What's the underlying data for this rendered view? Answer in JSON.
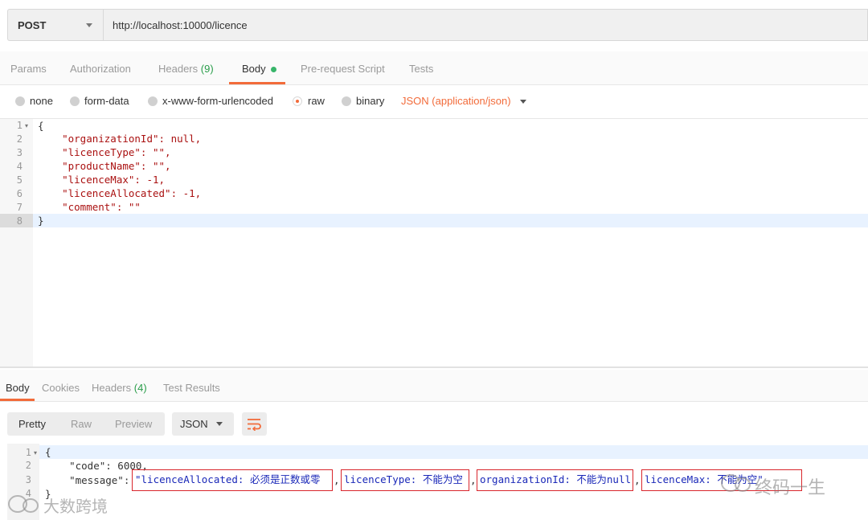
{
  "request": {
    "method": "POST",
    "url": "http://localhost:10000/licence"
  },
  "request_tabs": [
    {
      "label": "Params"
    },
    {
      "label": "Authorization"
    },
    {
      "label": "Headers",
      "count": "(9)"
    },
    {
      "label": "Body"
    },
    {
      "label": "Pre-request Script"
    },
    {
      "label": "Tests"
    }
  ],
  "body_types": {
    "none": "none",
    "form_data": "form-data",
    "urlencoded": "x-www-form-urlencoded",
    "raw": "raw",
    "binary": "binary",
    "json_type": "JSON (application/json)"
  },
  "request_body_lines": [
    {
      "num": "1",
      "text": "{"
    },
    {
      "num": "2",
      "text": "    \"organizationId\": null,"
    },
    {
      "num": "3",
      "text": "    \"licenceType\": \"\","
    },
    {
      "num": "4",
      "text": "    \"productName\": \"\","
    },
    {
      "num": "5",
      "text": "    \"licenceMax\": -1,"
    },
    {
      "num": "6",
      "text": "    \"licenceAllocated\": -1,"
    },
    {
      "num": "7",
      "text": "    \"comment\": \"\""
    },
    {
      "num": "8",
      "text": "}"
    }
  ],
  "response_tabs": [
    {
      "label": "Body"
    },
    {
      "label": "Cookies"
    },
    {
      "label": "Headers",
      "count": "(4)"
    },
    {
      "label": "Test Results"
    }
  ],
  "response_toolbar": {
    "pretty": "Pretty",
    "raw": "Raw",
    "preview": "Preview",
    "format": "JSON"
  },
  "response_lines": [
    {
      "num": "1",
      "text": "{"
    },
    {
      "num": "2",
      "text": "    \"code\": 6000,"
    },
    {
      "num": "3",
      "text": "    \"message\": "
    },
    {
      "num": "4",
      "text": "}"
    }
  ],
  "message_segments": [
    "\"licenceAllocated: 必须是正数或零",
    "licenceType: 不能为空",
    "organizationId: 不能为null",
    "licenceMax: 不能为空\""
  ],
  "watermarks": {
    "left": "大数跨境",
    "right": "终码一生"
  },
  "colors": {
    "accent": "#f26b3a",
    "count_green": "#2a9d4a",
    "highlight_red": "#d9262c",
    "message_blue": "#1a28b8"
  }
}
